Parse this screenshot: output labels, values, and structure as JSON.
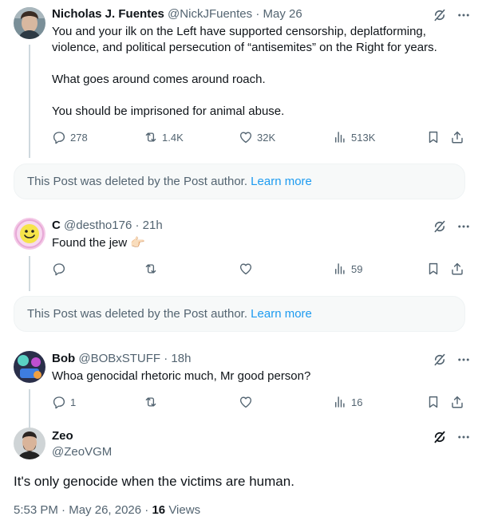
{
  "replies": [
    {
      "name": "Nicholas J. Fuentes",
      "handle": "@NickJFuentes",
      "time": "May 26",
      "paragraphs": [
        "You and your ilk on the Left have supported censorship, deplatforming, violence, and political persecution of “antisemites” on the Right for years.",
        "What goes around comes around roach.",
        "You should be imprisoned for animal abuse."
      ],
      "replies_count": "278",
      "reposts_count": "1.4K",
      "likes_count": "32K",
      "views_count": "513K"
    },
    {
      "name": "C",
      "handle": "@destho176",
      "time": "21h",
      "paragraphs": [
        "Found the jew 👉🏻"
      ],
      "replies_count": "",
      "reposts_count": "",
      "likes_count": "",
      "views_count": "59"
    },
    {
      "name": "Bob",
      "handle": "@BOBxSTUFF",
      "time": "18h",
      "paragraphs": [
        "Whoa genocidal rhetoric much, Mr good person?"
      ],
      "replies_count": "1",
      "reposts_count": "",
      "likes_count": "",
      "views_count": "16"
    }
  ],
  "deleted_notice": {
    "text": "This Post was deleted by the Post author. ",
    "link": "Learn more"
  },
  "main_post": {
    "name": "Zeo",
    "handle": "@ZeoVGM",
    "text": "It's only genocide when the victims are human.",
    "time": "5:53 PM",
    "date": "May 26, 2026",
    "views_count": "16",
    "views_label": "Views"
  },
  "separator_dot": "·",
  "icons": [
    "grok-icon",
    "more-icon",
    "reply-icon",
    "repost-icon",
    "like-icon",
    "views-icon",
    "bookmark-icon",
    "share-icon"
  ],
  "colors": {
    "link": "#1d9bf0",
    "secondary": "#536471",
    "line": "#cfd9de"
  }
}
